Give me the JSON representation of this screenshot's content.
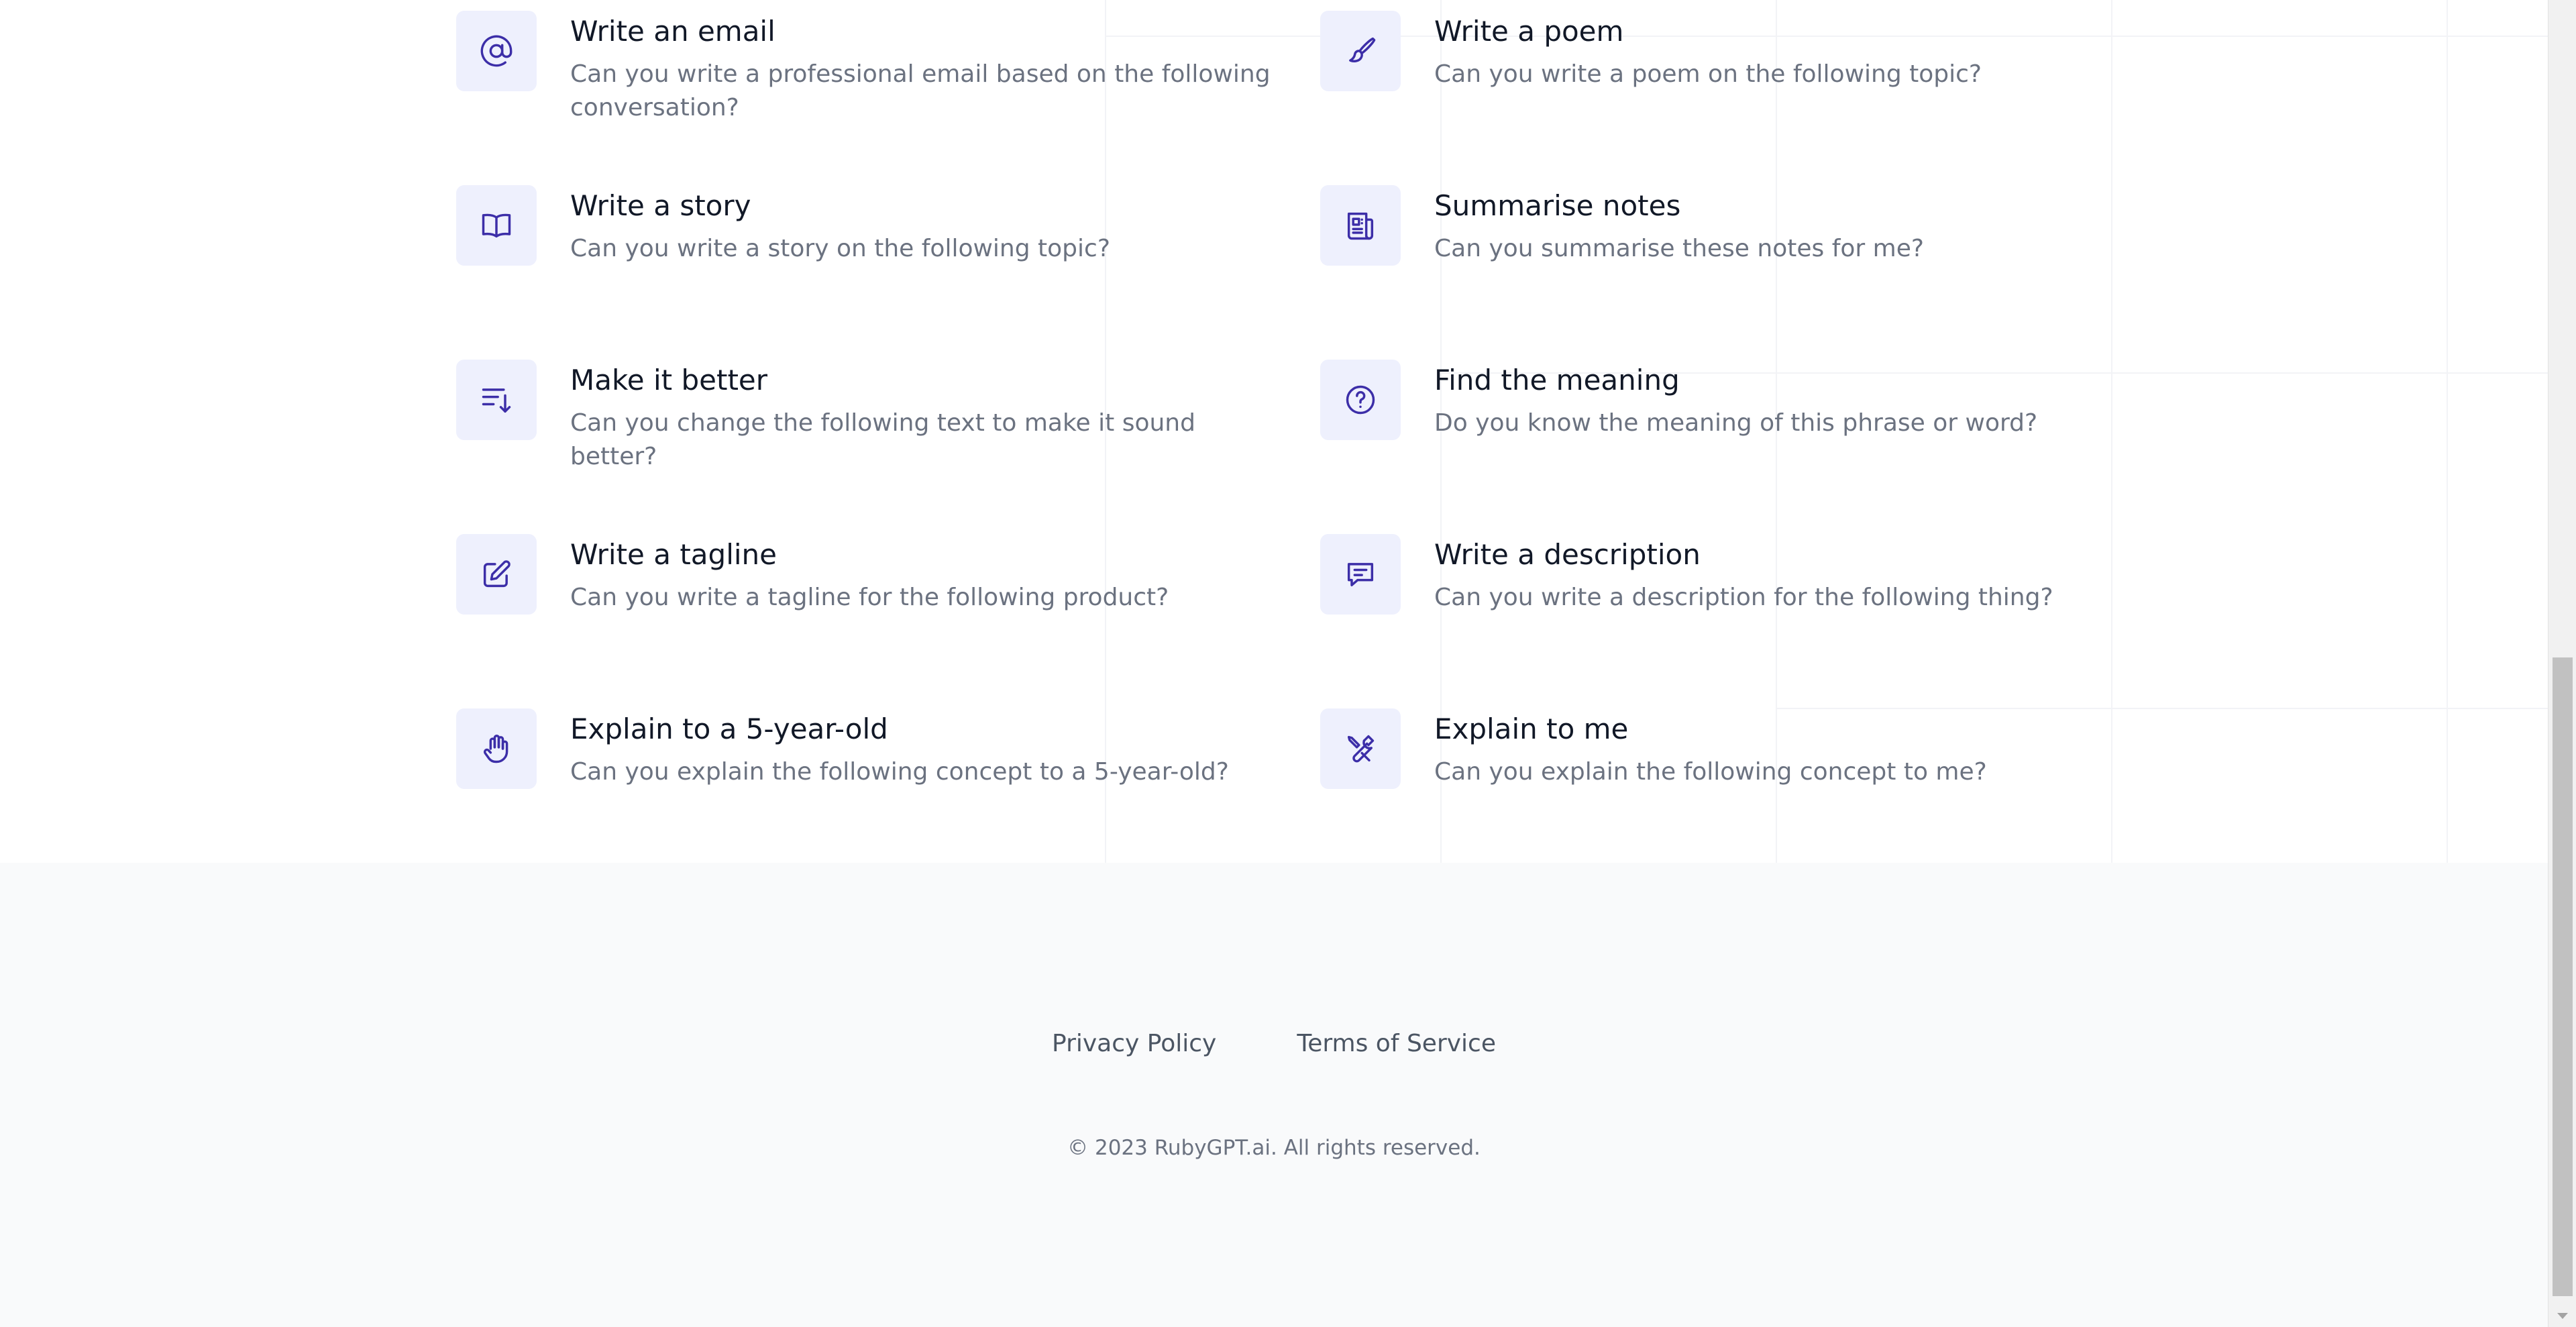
{
  "features": [
    {
      "title": "Write an email",
      "description": "Can you write a professional email based on the following conversation?",
      "icon": "at-sign-icon"
    },
    {
      "title": "Write a poem",
      "description": "Can you write a poem on the following topic?",
      "icon": "paintbrush-icon"
    },
    {
      "title": "Write a story",
      "description": "Can you write a story on the following topic?",
      "icon": "open-book-icon"
    },
    {
      "title": "Summarise notes",
      "description": "Can you summarise these notes for me?",
      "icon": "newspaper-icon"
    },
    {
      "title": "Make it better",
      "description": "Can you change the following text to make it sound better?",
      "icon": "sort-descending-icon"
    },
    {
      "title": "Find the meaning",
      "description": "Do you know the meaning of this phrase or word?",
      "icon": "question-circle-icon"
    },
    {
      "title": "Write a tagline",
      "description": "Can you write a tagline for the following product?",
      "icon": "pencil-square-icon"
    },
    {
      "title": "Write a description",
      "description": "Can you write a description for the following thing?",
      "icon": "chat-bubble-icon"
    },
    {
      "title": "Explain to a 5-year-old",
      "description": "Can you explain the following concept to a 5-year-old?",
      "icon": "hand-icon"
    },
    {
      "title": "Explain to me",
      "description": "Can you explain the following concept to me?",
      "icon": "tools-icon"
    }
  ],
  "footer": {
    "links": [
      "Privacy Policy",
      "Terms of Service"
    ],
    "copyright": "© 2023 RubyGPT.ai. All rights reserved."
  },
  "colors": {
    "accent": "#3c2ea8",
    "icon_bg": "#eef0fd",
    "footer_bg": "#f9fafb",
    "title_text": "#111827",
    "body_text": "#6b7280"
  }
}
